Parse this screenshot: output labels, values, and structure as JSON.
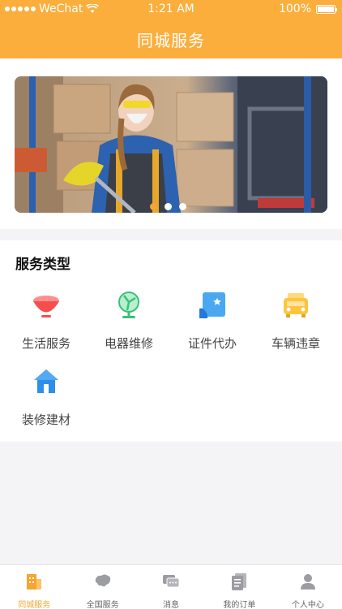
{
  "status_bar": {
    "carrier": "WeChat",
    "time": "1:21 AM",
    "battery": "100%"
  },
  "header": {
    "title": "同城服务"
  },
  "banner": {
    "slides": 3,
    "active_slide": 1
  },
  "services": {
    "title": "服务类型",
    "items": [
      {
        "label": "生活服务",
        "icon": "bowl-icon"
      },
      {
        "label": "电器维修",
        "icon": "fan-icon"
      },
      {
        "label": "证件代办",
        "icon": "document-icon"
      },
      {
        "label": "车辆违章",
        "icon": "car-icon"
      },
      {
        "label": "装修建材",
        "icon": "house-icon"
      }
    ]
  },
  "tabbar": {
    "tabs": [
      {
        "label": "同城服务",
        "icon": "city-service-icon",
        "active": true
      },
      {
        "label": "全国服务",
        "icon": "map-icon",
        "active": false
      },
      {
        "label": "消息",
        "icon": "message-icon",
        "active": false
      },
      {
        "label": "我的订单",
        "icon": "orders-icon",
        "active": false
      },
      {
        "label": "个人中心",
        "icon": "user-icon",
        "active": false
      }
    ]
  },
  "colors": {
    "accent": "#fbae3c",
    "active_tab": "#f6a531",
    "background": "#f4f4f7"
  }
}
